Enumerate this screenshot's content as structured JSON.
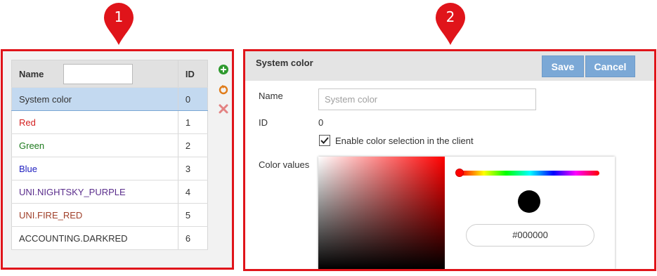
{
  "markers": [
    "1",
    "2"
  ],
  "list_panel": {
    "header_name": "Name",
    "header_id": "ID",
    "filter_value": "",
    "rows": [
      {
        "name": "System color",
        "id": "0",
        "color": "#333333",
        "selected": true
      },
      {
        "name": "Red",
        "id": "1",
        "color": "#d42020"
      },
      {
        "name": "Green",
        "id": "2",
        "color": "#1e7a1e"
      },
      {
        "name": "Blue",
        "id": "3",
        "color": "#2020c0"
      },
      {
        "name": "UNI.NIGHTSKY_PURPLE",
        "id": "4",
        "color": "#5a2d8c"
      },
      {
        "name": "UNI.FIRE_RED",
        "id": "5",
        "color": "#a0402a"
      },
      {
        "name": "ACCOUNTING.DARKRED",
        "id": "6",
        "color": "#333333"
      }
    ],
    "tools": [
      "add-icon",
      "refresh-icon",
      "delete-icon"
    ]
  },
  "detail_panel": {
    "title": "System color",
    "save_label": "Save",
    "cancel_label": "Cancel",
    "name_label": "Name",
    "name_placeholder": "System color",
    "id_label": "ID",
    "id_value": "0",
    "checkbox_label": "Enable color selection in the client",
    "checkbox_checked": true,
    "color_values_label": "Color values",
    "hex_value": "#000000"
  },
  "colors": {
    "highlight": "#e0141a",
    "button": "#7ba8d6",
    "selection": "#c3d9f0"
  }
}
